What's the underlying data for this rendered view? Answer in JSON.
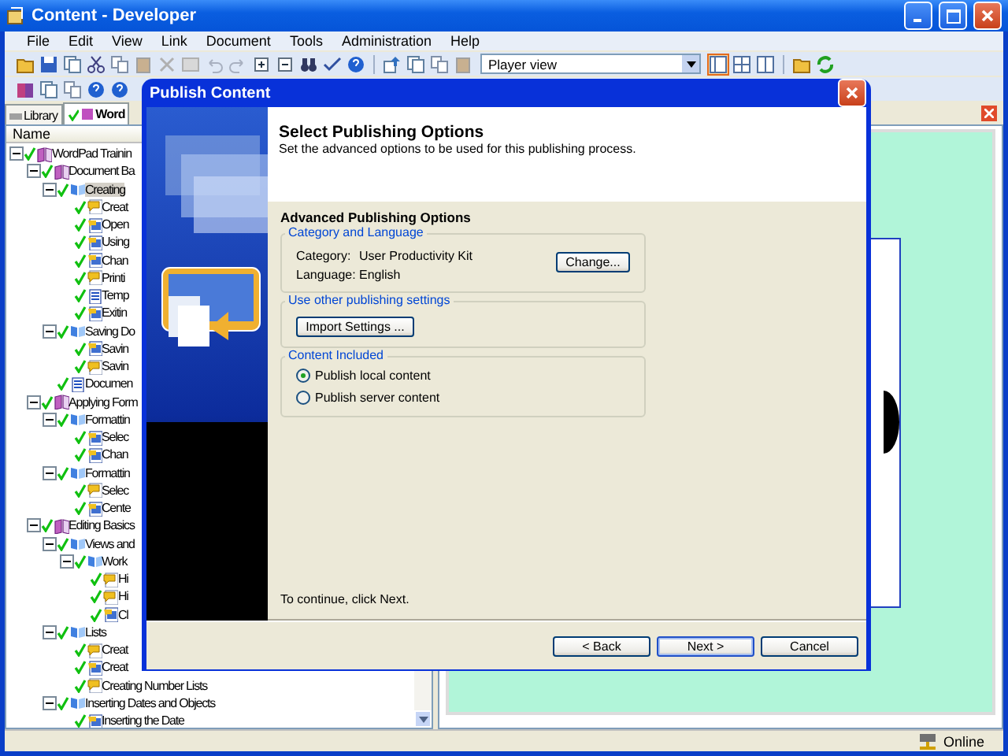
{
  "window": {
    "title": "Content - Developer"
  },
  "menu": [
    "File",
    "Edit",
    "View",
    "Link",
    "Document",
    "Tools",
    "Administration",
    "Help"
  ],
  "toolbar": {
    "view_select": "Player view"
  },
  "tabs": [
    {
      "label": "Library",
      "selected": false
    },
    {
      "label": "Word",
      "selected": true,
      "checked": true
    }
  ],
  "tree": {
    "header": "Name",
    "items": [
      {
        "label": "WordPad Trainin",
        "kind": "module",
        "checked": true,
        "expanded": true,
        "selected": false,
        "children": [
          {
            "label": "Document Ba",
            "kind": "module",
            "checked": true,
            "expanded": true,
            "selected": false,
            "children": [
              {
                "label": "Creating",
                "kind": "section",
                "checked": true,
                "expanded": true,
                "selected": true,
                "children": [
                  {
                    "label": "Creat",
                    "kind": "topic",
                    "checked": true,
                    "selected": false
                  },
                  {
                    "label": "Open",
                    "kind": "practice",
                    "checked": true,
                    "selected": false
                  },
                  {
                    "label": "Using",
                    "kind": "practice",
                    "checked": true,
                    "selected": false
                  },
                  {
                    "label": "Chan",
                    "kind": "practice",
                    "checked": true,
                    "selected": false
                  },
                  {
                    "label": "Printi",
                    "kind": "topic",
                    "checked": true,
                    "selected": false
                  },
                  {
                    "label": "Temp",
                    "kind": "document",
                    "checked": true,
                    "selected": false
                  },
                  {
                    "label": "Exitin",
                    "kind": "practice",
                    "checked": true,
                    "selected": false
                  }
                ]
              },
              {
                "label": "Saving Do",
                "kind": "section",
                "checked": true,
                "expanded": true,
                "selected": false,
                "children": [
                  {
                    "label": "Savin",
                    "kind": "practice",
                    "checked": true,
                    "selected": false
                  },
                  {
                    "label": "Savin",
                    "kind": "topic",
                    "checked": true,
                    "selected": false
                  }
                ]
              },
              {
                "label": "Documen",
                "kind": "document",
                "checked": true,
                "selected": false
              }
            ]
          },
          {
            "label": "Applying Form",
            "kind": "module",
            "checked": true,
            "expanded": true,
            "selected": false,
            "children": [
              {
                "label": "Formattin",
                "kind": "section",
                "checked": true,
                "expanded": true,
                "selected": false,
                "children": [
                  {
                    "label": "Selec",
                    "kind": "practice",
                    "checked": true,
                    "selected": false
                  },
                  {
                    "label": "Chan",
                    "kind": "practice",
                    "checked": true,
                    "selected": false
                  }
                ]
              },
              {
                "label": "Formattin",
                "kind": "section",
                "checked": true,
                "expanded": true,
                "selected": false,
                "children": [
                  {
                    "label": "Selec",
                    "kind": "topic",
                    "checked": true,
                    "selected": false
                  },
                  {
                    "label": "Cente",
                    "kind": "practice",
                    "checked": true,
                    "selected": false
                  }
                ]
              }
            ]
          },
          {
            "label": "Editing Basics",
            "kind": "module",
            "checked": true,
            "expanded": true,
            "selected": false,
            "children": [
              {
                "label": "Views and",
                "kind": "section",
                "checked": true,
                "expanded": true,
                "selected": false,
                "children": [
                  {
                    "label": "Work",
                    "kind": "section",
                    "checked": true,
                    "expanded": true,
                    "selected": false,
                    "children": [
                      {
                        "label": "Hi",
                        "kind": "topic",
                        "checked": true,
                        "selected": false
                      },
                      {
                        "label": "Hi",
                        "kind": "topic",
                        "checked": true,
                        "selected": false
                      },
                      {
                        "label": "Cl",
                        "kind": "practice",
                        "checked": true,
                        "selected": false
                      }
                    ]
                  }
                ]
              },
              {
                "label": "Lists",
                "kind": "section",
                "checked": true,
                "expanded": true,
                "selected": false,
                "children": [
                  {
                    "label": "Creat",
                    "kind": "topic",
                    "checked": true,
                    "selected": false
                  },
                  {
                    "label": "Creat",
                    "kind": "practice",
                    "checked": true,
                    "selected": false
                  },
                  {
                    "label": "Creating Number Lists",
                    "kind": "topic",
                    "checked": true,
                    "selected": false
                  }
                ]
              },
              {
                "label": "Inserting Dates and Objects",
                "kind": "section",
                "checked": true,
                "expanded": true,
                "selected": false,
                "children": [
                  {
                    "label": "Inserting the Date",
                    "kind": "practice",
                    "checked": true,
                    "selected": false
                  }
                ]
              }
            ]
          }
        ]
      }
    ]
  },
  "status_bar": {
    "connection": "Online"
  },
  "dialog": {
    "title": "Publish Content",
    "heading": "Select Publishing Options",
    "subheading": "Set the advanced options to be used for this publishing process.",
    "section_title": "Advanced Publishing Options",
    "category_group": {
      "title": "Category and Language",
      "fields": [
        {
          "label": "Category:",
          "value": "User Productivity Kit"
        },
        {
          "label": "Language:",
          "value": "English"
        }
      ],
      "button": "Change..."
    },
    "settings_group": {
      "title": "Use other publishing settings",
      "button": "Import Settings ..."
    },
    "content_group": {
      "title": "Content Included",
      "options": [
        {
          "label": "Publish local content",
          "selected": true
        },
        {
          "label": "Publish server content",
          "selected": false
        }
      ]
    },
    "note": "To continue, click Next.",
    "buttons": [
      {
        "label": "< Back",
        "default": false
      },
      {
        "label": "Next >",
        "default": true
      },
      {
        "label": "Cancel",
        "default": false
      }
    ]
  }
}
